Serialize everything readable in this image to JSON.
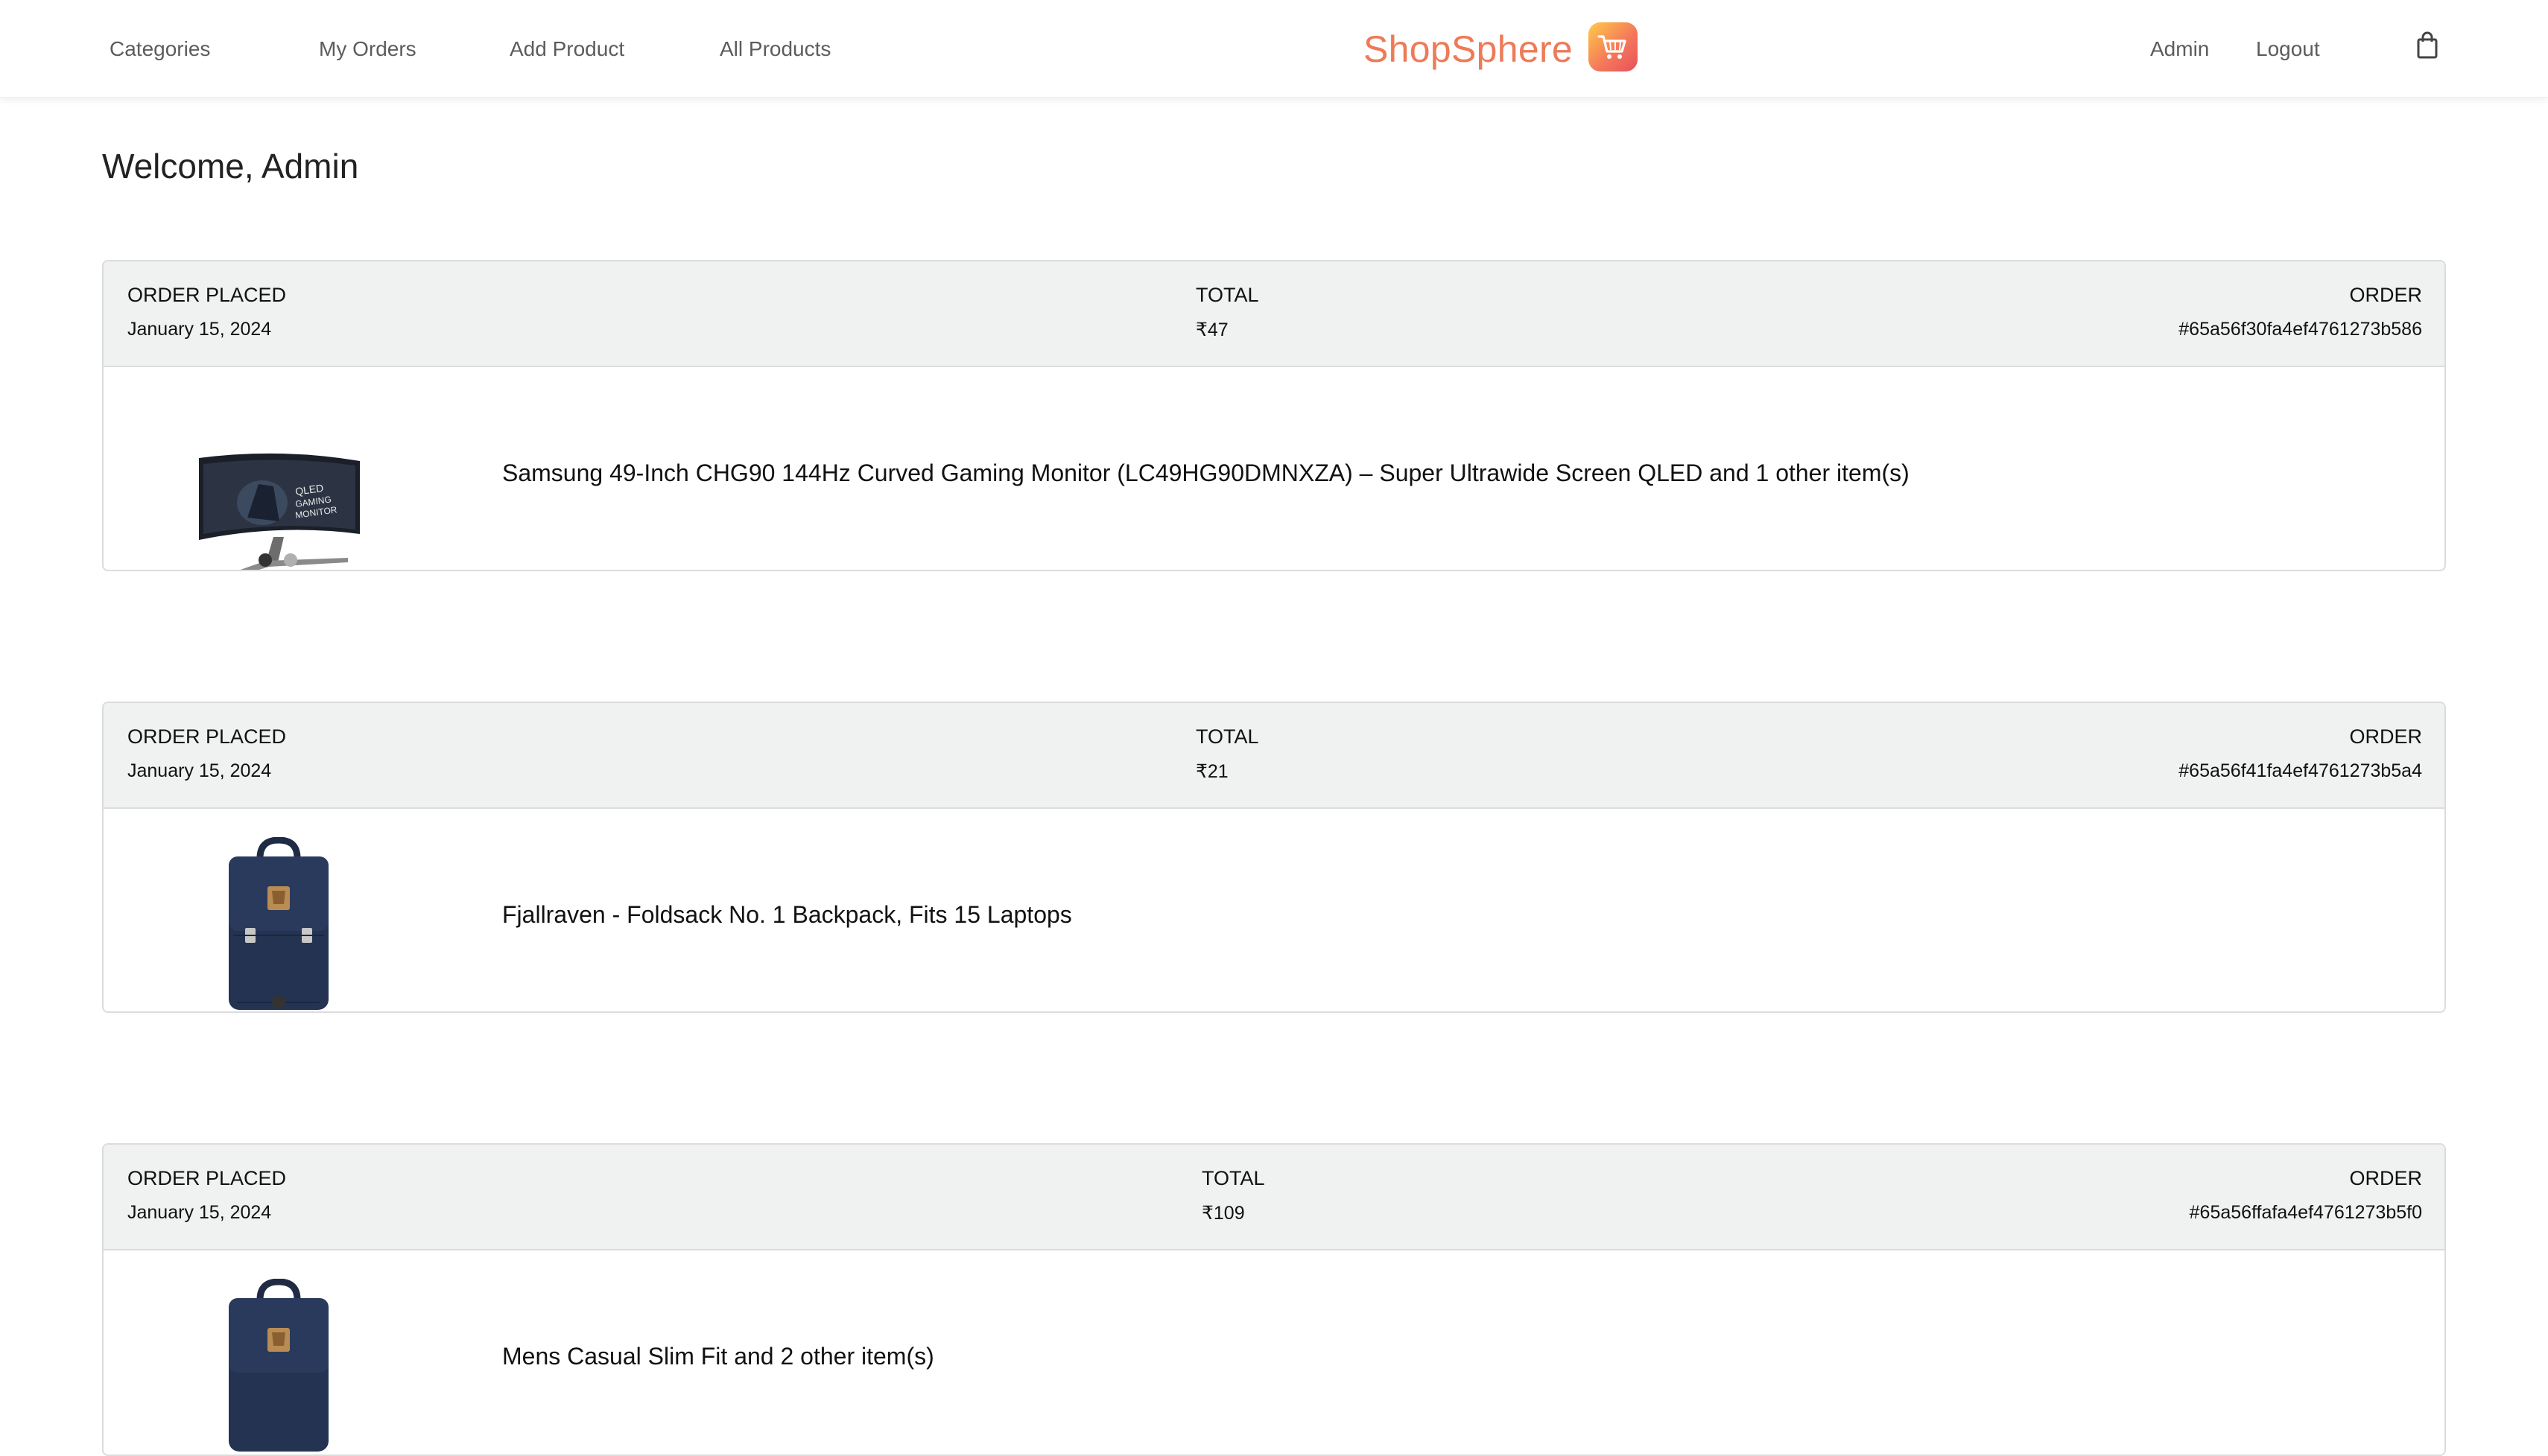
{
  "nav": {
    "links": [
      "Categories",
      "My Orders",
      "Add Product",
      "All Products"
    ],
    "brand": "ShopSphere",
    "right_links": [
      "Admin",
      "Logout"
    ]
  },
  "colors": {
    "brand": "#ee7a58",
    "header_bg": "#f0f1f1",
    "dot_active": "#333333",
    "dot_inactive": "#b0b0b0"
  },
  "welcome": "Welcome, Admin",
  "labels": {
    "placed": "ORDER PLACED",
    "total": "TOTAL",
    "order": "ORDER"
  },
  "orders": [
    {
      "date": "January 15, 2024",
      "total": "₹47",
      "id": "#65a56f30fa4ef4761273b586",
      "title": "Samsung 49-Inch CHG90 144Hz Curved Gaming Monitor (LC49HG90DMNXZA) – Super Ultrawide Screen QLED and 1 other item(s)",
      "image": "monitor",
      "dots": 2
    },
    {
      "date": "January 15, 2024",
      "total": "₹21",
      "id": "#65a56f41fa4ef4761273b5a4",
      "title": "Fjallraven - Foldsack No. 1 Backpack, Fits 15 Laptops",
      "image": "backpack",
      "dots": 1
    },
    {
      "date": "January 15, 2024",
      "total": "₹109",
      "id": "#65a56ffafa4ef4761273b5f0",
      "title": "Mens Casual Slim Fit and 2 other item(s)",
      "image": "backpack",
      "dots": 0
    }
  ]
}
